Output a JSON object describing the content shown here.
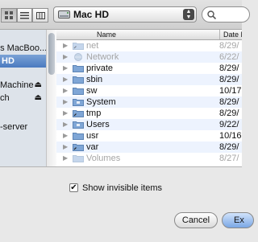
{
  "toolbar": {
    "location": "Mac HD"
  },
  "sidebar": {
    "items": [
      {
        "label": "'s MacBoo...",
        "selected": false,
        "eject": false
      },
      {
        "label": "HD",
        "selected": true,
        "eject": false
      },
      {
        "label": "Machine",
        "selected": false,
        "eject": true
      },
      {
        "label": "ch",
        "selected": false,
        "eject": true
      },
      {
        "label": "-server",
        "selected": false,
        "eject": false
      }
    ]
  },
  "list": {
    "col_name": "Name",
    "col_date": "Date M",
    "rows": [
      {
        "name": "net",
        "date": "8/29/",
        "dim": true,
        "icon": "folder-link-icon"
      },
      {
        "name": "Network",
        "date": "6/22/",
        "dim": true,
        "icon": "network-globe-icon"
      },
      {
        "name": "private",
        "date": "8/29/",
        "dim": false,
        "icon": "folder-icon"
      },
      {
        "name": "sbin",
        "date": "8/29/",
        "dim": false,
        "icon": "folder-icon"
      },
      {
        "name": "sw",
        "date": "10/17",
        "dim": false,
        "icon": "folder-icon"
      },
      {
        "name": "System",
        "date": "8/29/",
        "dim": false,
        "icon": "system-folder-icon"
      },
      {
        "name": "tmp",
        "date": "8/29/",
        "dim": false,
        "icon": "folder-alias-icon"
      },
      {
        "name": "Users",
        "date": "9/22/",
        "dim": false,
        "icon": "users-folder-icon"
      },
      {
        "name": "usr",
        "date": "10/16",
        "dim": false,
        "icon": "folder-icon"
      },
      {
        "name": "var",
        "date": "8/29/",
        "dim": false,
        "icon": "folder-alias-icon"
      },
      {
        "name": "Volumes",
        "date": "8/27/",
        "dim": true,
        "icon": "folder-icon"
      }
    ]
  },
  "options": {
    "show_invisible_label": "Show invisible items",
    "show_invisible_checked": true,
    "check_mark": "✔"
  },
  "buttons": {
    "cancel": "Cancel",
    "confirm": "Ex"
  },
  "colors": {
    "selection": "#4a7ac0",
    "sidebar_bg": "#dde3ea",
    "alt_row": "#edf3fe",
    "folder": "#7fa6d6"
  }
}
